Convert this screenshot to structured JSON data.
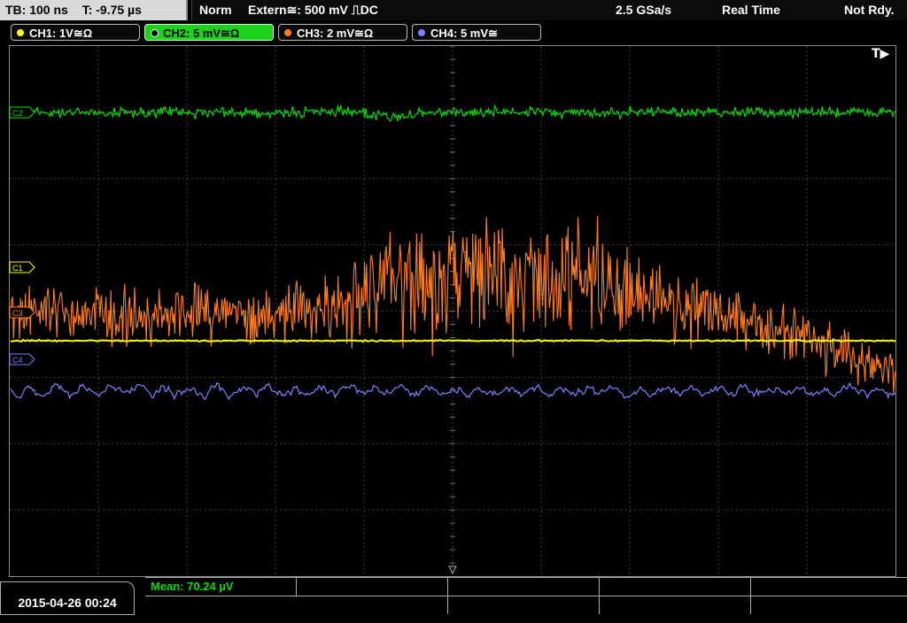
{
  "timebase": {
    "tb": "TB: 100 ns",
    "t": "T: -9.75 µs"
  },
  "acquisition": {
    "mode": "Norm",
    "trigger": "Extern≅: 500 mV ⎍DC",
    "sample_rate": "2.5 GSa/s",
    "run_mode": "Real Time",
    "status": "Not Rdy."
  },
  "channels": [
    {
      "label": "CH1: 1V≅Ω",
      "color": "#ffff00",
      "marker": "C1"
    },
    {
      "label": "CH2: 5 mV≅Ω",
      "color": "#00e000",
      "marker": "C2",
      "active": true
    },
    {
      "label": "CH3: 2 mV≅Ω",
      "color": "#ff7f1f",
      "marker": "C3"
    },
    {
      "label": "CH4: 5 mV≅",
      "color": "#8080ff",
      "marker": "C4"
    }
  ],
  "trigger_marker": "T▶",
  "timestamp": "2015-04-26 00:24",
  "measurement": {
    "mean": "Mean: 70.24 µV",
    "color": "#00e000"
  }
}
